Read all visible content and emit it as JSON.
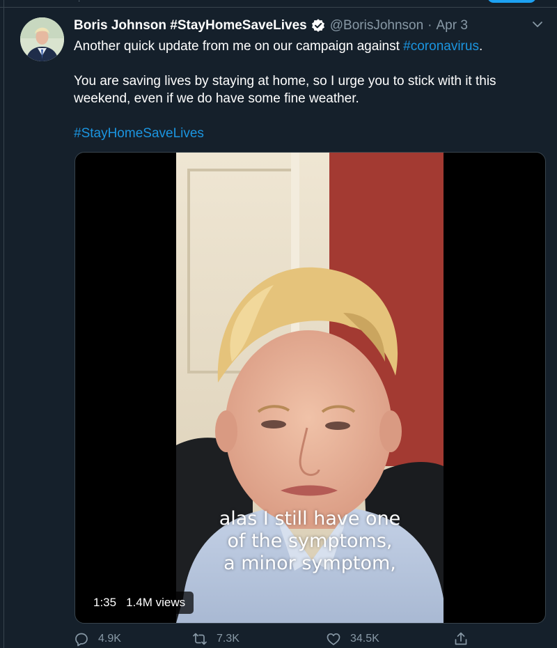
{
  "tweet": {
    "display_name": "Boris Johnson #StayHomeSaveLives",
    "handle": "@BorisJohnson",
    "separator": "·",
    "date": "Apr 3",
    "verified": true,
    "text_line1_prefix": "Another quick update from me on our campaign against ",
    "text_line1_hashtag": "#coronavirus",
    "text_line1_suffix": ".",
    "text_para2": "You are saving lives by staying at home, so I urge you to stick with it this weekend, even if we do have some fine weather.",
    "text_hashtag": "#StayHomeSaveLives"
  },
  "media": {
    "captions": [
      "alas I still have one",
      "of the symptoms,",
      "a minor symptom,"
    ],
    "duration": "1:35",
    "views": "1.4M views"
  },
  "actions": {
    "reply_count": "4.9K",
    "retweet_count": "7.3K",
    "like_count": "34.5K"
  },
  "icons": {
    "verified": "verified-badge-icon",
    "more": "chevron-down-icon",
    "reply": "reply-icon",
    "retweet": "retweet-icon",
    "like": "heart-icon",
    "share": "share-icon"
  },
  "colors": {
    "background": "#15202b",
    "link": "#1b95e0",
    "muted": "#8899a6",
    "border": "#38444d"
  }
}
